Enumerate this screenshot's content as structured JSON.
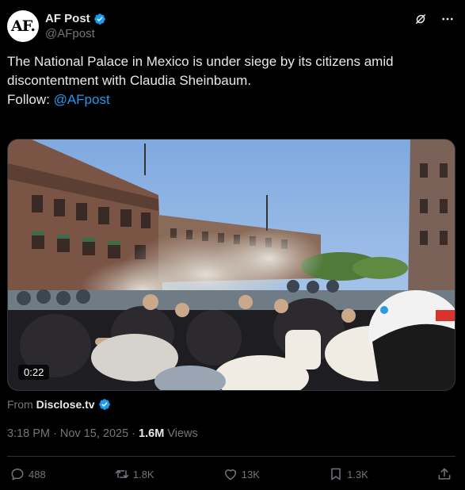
{
  "author": {
    "avatar_text": "AF.",
    "display_name": "AF Post",
    "handle": "@AFpost",
    "verified": true
  },
  "header_icons": [
    "grok-icon",
    "more-icon"
  ],
  "tweet": {
    "text": "The National Palace in Mexico is under siege by its citizens amid discontentment with Claudia Sheinbaum.",
    "follow_prefix": "Follow: ",
    "follow_mention": "@AFpost"
  },
  "media": {
    "type": "video",
    "duration": "0:22"
  },
  "source": {
    "prefix": "From",
    "name": "Disclose.tv",
    "verified": true
  },
  "meta": {
    "time": "3:18 PM",
    "separator": " · ",
    "date": "Nov 15, 2025",
    "views_count": "1.6M",
    "views_label": "Views"
  },
  "actions": {
    "replies": "488",
    "reposts": "1.8K",
    "likes": "13K",
    "bookmarks": "1.3K"
  },
  "colors": {
    "background": "#000000",
    "text": "#e7e9ea",
    "muted": "#71767b",
    "link": "#1d9bf0",
    "verified": "#1d9bf0"
  }
}
